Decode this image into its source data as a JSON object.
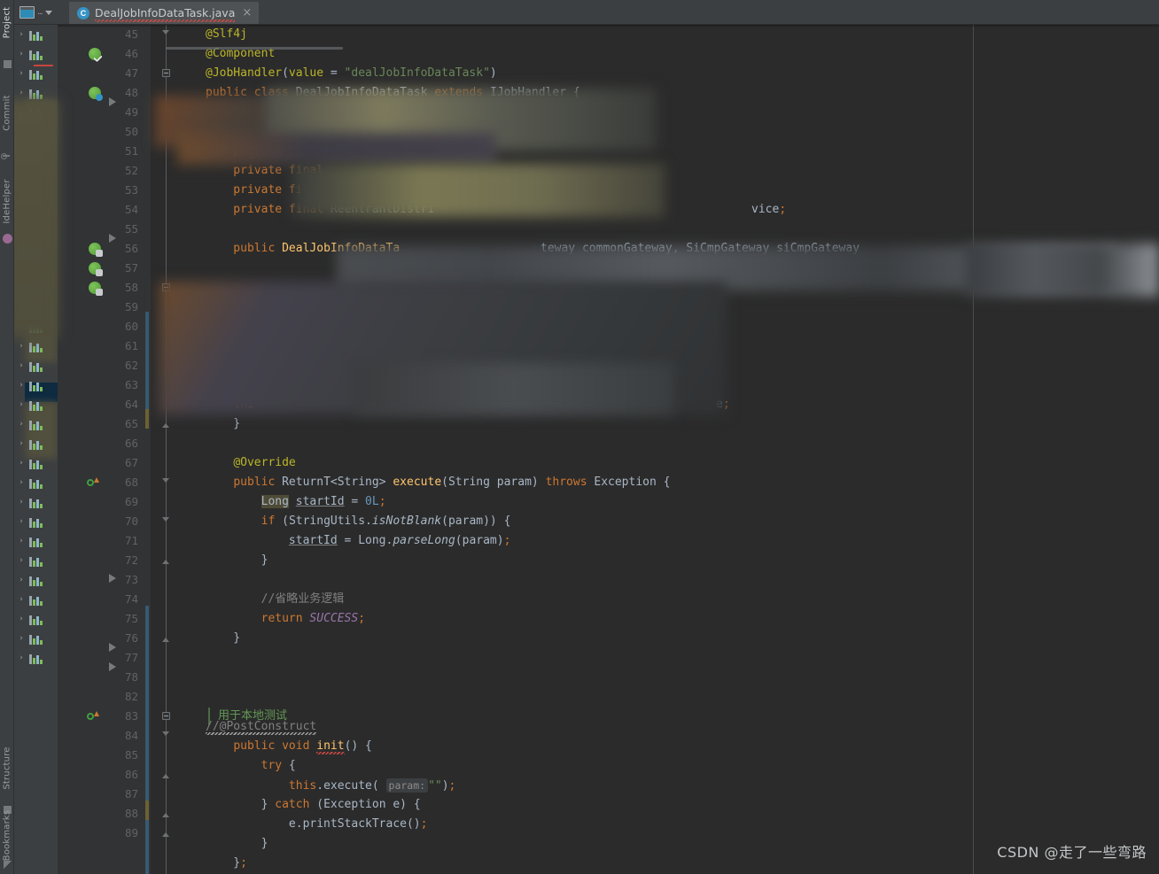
{
  "window": {
    "title": "DealJobInfoDataTask.java",
    "theme": "Darcula",
    "accent": "#3592c4"
  },
  "tool_strip": {
    "tabs": [
      {
        "label": "Project",
        "selected": true
      },
      {
        "label": "Commit",
        "selected": false
      },
      {
        "label": "IdeHelper",
        "selected": false
      },
      {
        "label": "Structure",
        "selected": false
      },
      {
        "label": "Bookmarks",
        "selected": false
      }
    ]
  },
  "tabbar": {
    "view_selector_label": "...",
    "tab": {
      "icon": "java-class-icon",
      "icon_letter": "C",
      "label": "DealJobInfoDataTask.java",
      "close_label": "×",
      "has_error_underline": true
    }
  },
  "sidebar": {
    "name": "project-tree",
    "redacted": true,
    "row_icon": "module-icon",
    "chevron": "›",
    "rows": 33
  },
  "folded_region": {
    "text": "用于本地测试",
    "color": "#629755"
  },
  "watermark": {
    "text": "CSDN @走了一些弯路"
  },
  "editor": {
    "language": "Java",
    "first_visible_line": 45,
    "last_visible_line": 89,
    "hidden_lines": [
      79,
      80,
      81
    ],
    "colors": {
      "background": "#2b2b2b",
      "gutter": "#313335",
      "line_number": "#606366",
      "text": "#a9b7c6",
      "keyword": "#cc7832",
      "annotation": "#bbb529",
      "string": "#6a8759",
      "comment": "#808080",
      "number": "#6897bb",
      "method": "#ffc66d",
      "static_field": "#9876aa",
      "vcs_added": "#375a71",
      "vcs_modified": "#6d6133"
    },
    "lines": [
      {
        "n": 45,
        "text": "@Slf4j"
      },
      {
        "n": 46,
        "text": "@Component"
      },
      {
        "n": 47,
        "text": "@JobHandler(value = \"dealJobInfoDataTask\")"
      },
      {
        "n": 48,
        "text": "public class DealJobInfoDataTask extends IJobHandler {"
      },
      {
        "n": 49,
        "text": "    private final ...",
        "redacted": true
      },
      {
        "n": 50,
        "text": ""
      },
      {
        "n": 51,
        "text": "    private ...",
        "redacted": true
      },
      {
        "n": 52,
        "text": "    private final ...",
        "redacted": true
      },
      {
        "n": 53,
        "text": "    private final JobCapt...",
        "redacted": true
      },
      {
        "n": 54,
        "text": "    private final ReentrantDistri... ...vice;",
        "redacted": true
      },
      {
        "n": 55,
        "text": ""
      },
      {
        "n": 56,
        "text": "    public DealJobInfoDataTask(... ...ateway commonGateway, SiCmpGateway siCmpGateway",
        "redacted": true
      },
      {
        "n": 57,
        "text": "",
        "redacted": true
      },
      {
        "n": 58,
        "text": "",
        "redacted": true
      },
      {
        "n": 59,
        "text": "        ... y;",
        "redacted": true
      },
      {
        "n": 60,
        "text": ""
      },
      {
        "n": 61,
        "text": "        thi... ...teway;",
        "redacted": true
      },
      {
        "n": 62,
        "text": "        th... ...way;",
        "redacted": true
      },
      {
        "n": 63,
        "text": "        th...",
        "redacted": true
      },
      {
        "n": 64,
        "text": "        thi... ...e;",
        "redacted": true
      },
      {
        "n": 65,
        "text": "    }"
      },
      {
        "n": 66,
        "text": ""
      },
      {
        "n": 67,
        "text": "    @Override"
      },
      {
        "n": 68,
        "text": "    public ReturnT<String> execute(String param) throws Exception {"
      },
      {
        "n": 69,
        "text": "        Long startId = 0L;"
      },
      {
        "n": 70,
        "text": "        if (StringUtils.isNotBlank(param)) {"
      },
      {
        "n": 71,
        "text": "            startId = Long.parseLong(param);"
      },
      {
        "n": 72,
        "text": "        }"
      },
      {
        "n": 73,
        "text": ""
      },
      {
        "n": 74,
        "text": "        //省略业务逻辑"
      },
      {
        "n": 75,
        "text": "        return SUCCESS;"
      },
      {
        "n": 76,
        "text": "    }"
      },
      {
        "n": 77,
        "text": ""
      },
      {
        "n": 78,
        "text": ""
      },
      {
        "n": 82,
        "text": "    //@PostConstruct"
      },
      {
        "n": 83,
        "text": "    public void init() {"
      },
      {
        "n": 84,
        "text": "        try {"
      },
      {
        "n": 85,
        "text": "            this.execute( param: \"\");"
      },
      {
        "n": 86,
        "text": "        } catch (Exception e) {"
      },
      {
        "n": 87,
        "text": "            e.printStackTrace();"
      },
      {
        "n": 88,
        "text": "        }"
      },
      {
        "n": 89,
        "text": "    };"
      }
    ],
    "inlay_hints": [
      {
        "line": 85,
        "label": "param:"
      }
    ],
    "gutter_icons": [
      {
        "line": 46,
        "icon": "spring-bean-icon"
      },
      {
        "line": 48,
        "icon": "spring-bean-component-icon"
      },
      {
        "line": 56,
        "icon": "spring-bean-autowire-icon"
      },
      {
        "line": 57,
        "icon": "spring-bean-autowire-icon"
      },
      {
        "line": 58,
        "icon": "spring-bean-autowire-icon"
      },
      {
        "line": 68,
        "icon": "overriding-method-icon"
      },
      {
        "line": 83,
        "icon": "overriding-method-icon"
      }
    ]
  }
}
